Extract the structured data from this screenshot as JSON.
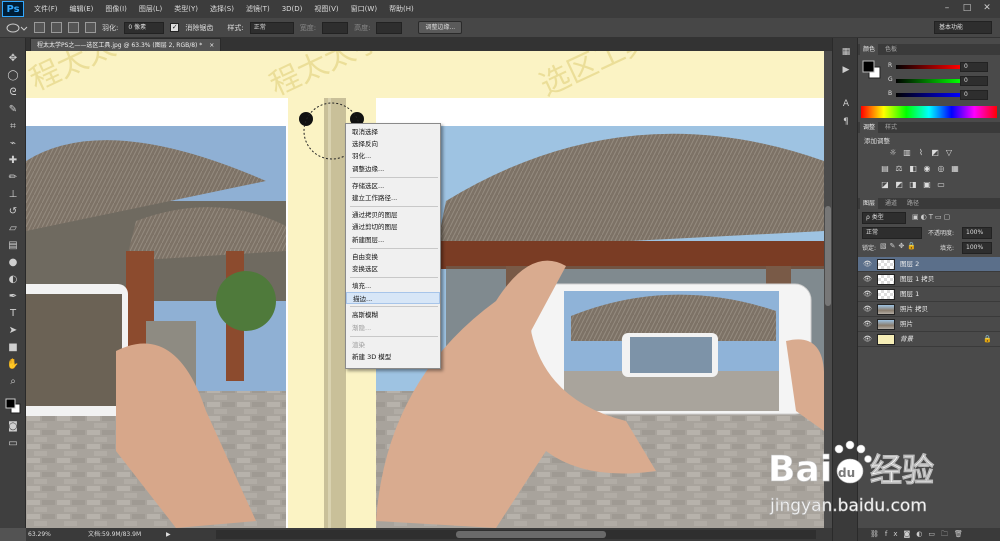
{
  "app": {
    "logo": "Ps"
  },
  "menubar": {
    "items": [
      "文件(F)",
      "编辑(E)",
      "图像(I)",
      "图层(L)",
      "类型(Y)",
      "选择(S)",
      "滤镜(T)",
      "3D(D)",
      "视图(V)",
      "窗口(W)",
      "帮助(H)"
    ],
    "minimize": "–",
    "maximize": "□",
    "close": "✕"
  },
  "options": {
    "feather_label": "羽化:",
    "feather_value": "0 像素",
    "antialias_label": "消除锯齿",
    "style_label": "样式:",
    "style_value": "正常",
    "width_label": "宽度:",
    "height_label": "高度:",
    "refine_button": "调整边缘...",
    "workspace": "基本功能"
  },
  "document": {
    "tab_title": "程太太学PS之——选区工具.jpg @ 63.3% (图层 2, RGB/8) *",
    "close": "×"
  },
  "status": {
    "zoom": "63.29%",
    "doc_info": "文档:59.9M/83.9M"
  },
  "context_menu": {
    "groups": [
      [
        {
          "label": "取消选择"
        },
        {
          "label": "选择反向"
        },
        {
          "label": "羽化..."
        },
        {
          "label": "调整边缘..."
        }
      ],
      [
        {
          "label": "存储选区..."
        },
        {
          "label": "建立工作路径..."
        }
      ],
      [
        {
          "label": "通过拷贝的图层"
        },
        {
          "label": "通过剪切的图层"
        },
        {
          "label": "新建图层..."
        }
      ],
      [
        {
          "label": "自由变换"
        },
        {
          "label": "变换选区"
        }
      ],
      [
        {
          "label": "填充..."
        },
        {
          "label": "描边...",
          "active": true
        }
      ],
      [
        {
          "label": "高斯模糊"
        },
        {
          "label": "渐隐...",
          "disabled": true
        }
      ],
      [
        {
          "label": "渲染",
          "disabled": true
        },
        {
          "label": "新建 3D 模型"
        }
      ]
    ]
  },
  "color_panel": {
    "tabs": [
      "颜色",
      "色板"
    ],
    "r": {
      "label": "R",
      "value": "0"
    },
    "g": {
      "label": "G",
      "value": "0"
    },
    "b": {
      "label": "B",
      "value": "0"
    }
  },
  "adjust_panel": {
    "tabs": [
      "调整",
      "样式"
    ],
    "title": "添加调整"
  },
  "layers_panel": {
    "tabs": [
      "图层",
      "通道",
      "路径"
    ],
    "kind_label": "ρ 类型",
    "blend_mode": "正常",
    "opacity_label": "不透明度:",
    "opacity_value": "100%",
    "lock_label": "锁定:",
    "fill_label": "填充:",
    "fill_value": "100%",
    "layers": [
      {
        "name": "图层 2",
        "selected": true,
        "thumb": "checker"
      },
      {
        "name": "图层 1 拷贝",
        "thumb": "checker"
      },
      {
        "name": "图层 1",
        "thumb": "checker"
      },
      {
        "name": "照片 拷贝",
        "thumb": "photo"
      },
      {
        "name": "照片",
        "thumb": "photo"
      },
      {
        "name": "背景",
        "locked": true,
        "thumb": "yellow"
      }
    ]
  },
  "watermark": {
    "brand_latin": "Bai",
    "brand_du": "du",
    "brand_cn": "经验",
    "url": "jingyan.baidu.com"
  },
  "colors": {
    "ui_dark": "#3c3c3c",
    "panel": "#4a4a4a",
    "selected_layer": "#5b6f8a",
    "canvas_bg": "#fbf3c4"
  }
}
